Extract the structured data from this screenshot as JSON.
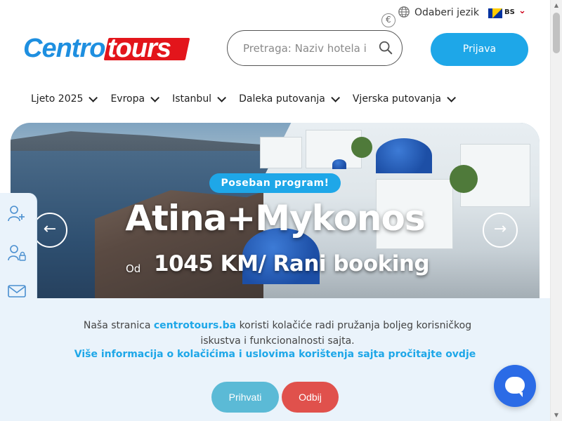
{
  "header": {
    "currency_icon": "euro-icon",
    "language_label": "Odaberi jezik",
    "language_code": "BS",
    "logo_part1": "Centro",
    "logo_part2": "tours",
    "search_placeholder": "Pretraga: Naziv hotela i",
    "login_label": "Prijava"
  },
  "nav": {
    "items": [
      {
        "label": "Ljeto 2025"
      },
      {
        "label": "Evropa"
      },
      {
        "label": "Istanbul"
      },
      {
        "label": "Daleka putovanja"
      },
      {
        "label": "Vjerska putovanja"
      }
    ]
  },
  "hero": {
    "badge": "Poseban program!",
    "title": "Atina+Mykonos",
    "price_prefix": "Od",
    "price": "1045 KM/ Rani booking",
    "prev_arrow": "←",
    "next_arrow": "→"
  },
  "cookie": {
    "text_before": "Naša stranica ",
    "site": "centrotours.ba",
    "text_after": " koristi kolačiće radi pružanja boljeg korisničkog iskustva i funkcionalnosti sajta.",
    "more_link": "Više informacija o kolačićima i uslovima korištenja sajta pročitajte ovdje",
    "accept_label": "Prihvati",
    "reject_label": "Odbij"
  },
  "colors": {
    "accent_blue": "#1ea7e8",
    "brand_red": "#e3151b",
    "reject_red": "#e0514c",
    "chat_blue": "#2b6be6"
  }
}
